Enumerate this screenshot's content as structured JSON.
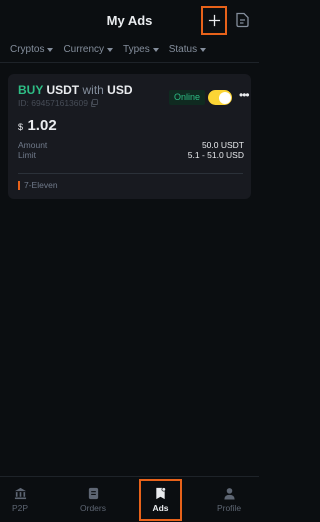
{
  "header": {
    "title": "My Ads"
  },
  "filters": [
    {
      "label": "Cryptos"
    },
    {
      "label": "Currency"
    },
    {
      "label": "Types"
    },
    {
      "label": "Status"
    }
  ],
  "ad": {
    "side": "BUY",
    "asset": "USDT",
    "with_word": "with",
    "fiat": "USD",
    "id": "ID: 694571613609",
    "status": "Online",
    "toggle_on": true,
    "price_symbol": "$",
    "price": "1.02",
    "amount_label": "Amount",
    "amount_value": "50.0 USDT",
    "limit_label": "Limit",
    "limit_value": "5.1 - 51.0 USD",
    "payment_method": "7-Eleven"
  },
  "nav": {
    "p2p": "P2P",
    "orders": "Orders",
    "ads": "Ads",
    "profile": "Profile"
  },
  "colors": {
    "buy_green": "#2ebd85",
    "accent_yellow": "#fcd535",
    "highlight_orange": "#e8621a",
    "background": "#0b0e11",
    "card": "#181a20"
  },
  "icons": [
    "plus-icon",
    "document-icon",
    "copy-icon",
    "more-icon",
    "bank-icon",
    "orders-icon",
    "ads-icon",
    "profile-icon"
  ]
}
